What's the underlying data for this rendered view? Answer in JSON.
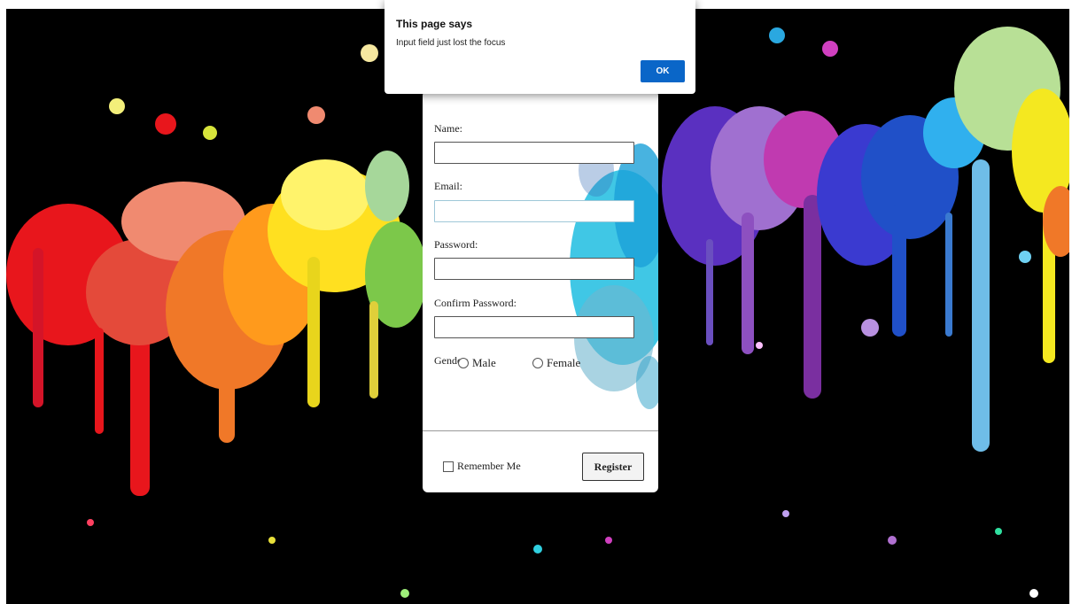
{
  "alert": {
    "title": "This page says",
    "message": "Input field just lost the focus",
    "ok_label": "OK"
  },
  "form": {
    "name_label": "Name:",
    "email_label": "Email:",
    "password_label": "Password:",
    "confirm_password_label": "Confirm Password:",
    "gender_label": "Gender:",
    "gender_options": [
      "Male",
      "Female"
    ],
    "remember_label": "Remember Me",
    "register_label": "Register",
    "name_value": "",
    "email_value": "",
    "password_value": "",
    "confirm_password_value": ""
  },
  "colors": {
    "ok_button": "#0a66c8",
    "background": "#000000"
  }
}
